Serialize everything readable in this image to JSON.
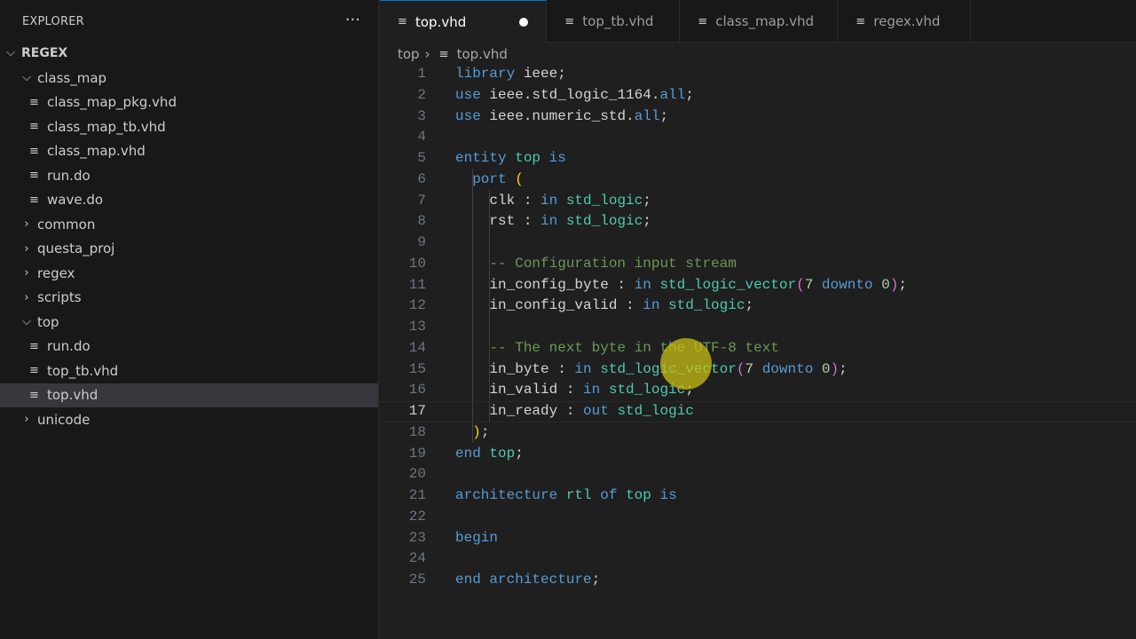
{
  "sidebar": {
    "title": "EXPLORER",
    "more": "···",
    "root": "REGEX",
    "items": [
      {
        "label": "class_map",
        "type": "folder",
        "open": true,
        "depth": 1
      },
      {
        "label": "class_map_pkg.vhd",
        "type": "file",
        "depth": 2
      },
      {
        "label": "class_map_tb.vhd",
        "type": "file",
        "depth": 2
      },
      {
        "label": "class_map.vhd",
        "type": "file",
        "depth": 2
      },
      {
        "label": "run.do",
        "type": "file",
        "depth": 2
      },
      {
        "label": "wave.do",
        "type": "file",
        "depth": 2
      },
      {
        "label": "common",
        "type": "folder",
        "open": false,
        "depth": 1
      },
      {
        "label": "questa_proj",
        "type": "folder",
        "open": false,
        "depth": 1
      },
      {
        "label": "regex",
        "type": "folder",
        "open": false,
        "depth": 1
      },
      {
        "label": "scripts",
        "type": "folder",
        "open": false,
        "depth": 1
      },
      {
        "label": "top",
        "type": "folder",
        "open": true,
        "depth": 1
      },
      {
        "label": "run.do",
        "type": "file",
        "depth": 2
      },
      {
        "label": "top_tb.vhd",
        "type": "file",
        "depth": 2
      },
      {
        "label": "top.vhd",
        "type": "file",
        "depth": 2,
        "selected": true
      },
      {
        "label": "unicode",
        "type": "folder",
        "open": false,
        "depth": 1
      }
    ]
  },
  "tabs": [
    {
      "label": "top.vhd",
      "active": true,
      "modified": true
    },
    {
      "label": "top_tb.vhd"
    },
    {
      "label": "class_map.vhd"
    },
    {
      "label": "regex.vhd"
    }
  ],
  "breadcrumb": {
    "folder": "top",
    "file": "top.vhd"
  },
  "editor": {
    "current_line": 17,
    "lines": [
      [
        [
          "kw",
          "library"
        ],
        [
          "id",
          " ieee;"
        ]
      ],
      [
        [
          "kw",
          "use"
        ],
        [
          "id",
          " ieee.std_logic_1164."
        ],
        [
          "kw",
          "all"
        ],
        [
          "id",
          ";"
        ]
      ],
      [
        [
          "kw",
          "use"
        ],
        [
          "id",
          " ieee.numeric_std."
        ],
        [
          "kw",
          "all"
        ],
        [
          "id",
          ";"
        ]
      ],
      [],
      [
        [
          "kw",
          "entity"
        ],
        [
          "id",
          " "
        ],
        [
          "ty",
          "top"
        ],
        [
          "id",
          " "
        ],
        [
          "kw",
          "is"
        ]
      ],
      [
        [
          "id",
          "  "
        ],
        [
          "kw",
          "port"
        ],
        [
          "id",
          " "
        ],
        [
          "p1",
          "("
        ]
      ],
      [
        [
          "id",
          "    clk : "
        ],
        [
          "kw",
          "in"
        ],
        [
          "id",
          " "
        ],
        [
          "ty",
          "std_logic"
        ],
        [
          "id",
          ";"
        ]
      ],
      [
        [
          "id",
          "    rst : "
        ],
        [
          "kw",
          "in"
        ],
        [
          "id",
          " "
        ],
        [
          "ty",
          "std_logic"
        ],
        [
          "id",
          ";"
        ]
      ],
      [],
      [
        [
          "id",
          "    "
        ],
        [
          "cm",
          "-- Configuration input stream"
        ]
      ],
      [
        [
          "id",
          "    in_config_byte : "
        ],
        [
          "kw",
          "in"
        ],
        [
          "id",
          " "
        ],
        [
          "ty",
          "std_logic_vector"
        ],
        [
          "p2",
          "("
        ],
        [
          "nm",
          "7"
        ],
        [
          "id",
          " "
        ],
        [
          "kw",
          "downto"
        ],
        [
          "id",
          " "
        ],
        [
          "nm",
          "0"
        ],
        [
          "p2",
          ")"
        ],
        [
          "id",
          ";"
        ]
      ],
      [
        [
          "id",
          "    in_config_valid : "
        ],
        [
          "kw",
          "in"
        ],
        [
          "id",
          " "
        ],
        [
          "ty",
          "std_logic"
        ],
        [
          "id",
          ";"
        ]
      ],
      [],
      [
        [
          "id",
          "    "
        ],
        [
          "cm",
          "-- The next byte in the UTF-8 text"
        ]
      ],
      [
        [
          "id",
          "    in_byte : "
        ],
        [
          "kw",
          "in"
        ],
        [
          "id",
          " "
        ],
        [
          "ty",
          "std_logic_vector"
        ],
        [
          "p2",
          "("
        ],
        [
          "nm",
          "7"
        ],
        [
          "id",
          " "
        ],
        [
          "kw",
          "downto"
        ],
        [
          "id",
          " "
        ],
        [
          "nm",
          "0"
        ],
        [
          "p2",
          ")"
        ],
        [
          "id",
          ";"
        ]
      ],
      [
        [
          "id",
          "    in_valid : "
        ],
        [
          "kw",
          "in"
        ],
        [
          "id",
          " "
        ],
        [
          "ty",
          "std_logic"
        ],
        [
          "id",
          ";"
        ]
      ],
      [
        [
          "id",
          "    in_ready : "
        ],
        [
          "kw",
          "out"
        ],
        [
          "id",
          " "
        ],
        [
          "ty",
          "std_logic"
        ]
      ],
      [
        [
          "id",
          "  "
        ],
        [
          "p1",
          ")"
        ],
        [
          "id",
          ";"
        ]
      ],
      [
        [
          "kw",
          "end"
        ],
        [
          "id",
          " "
        ],
        [
          "ty",
          "top"
        ],
        [
          "id",
          ";"
        ]
      ],
      [],
      [
        [
          "kw",
          "architecture"
        ],
        [
          "id",
          " "
        ],
        [
          "ty",
          "rtl"
        ],
        [
          "id",
          " "
        ],
        [
          "kw",
          "of"
        ],
        [
          "id",
          " "
        ],
        [
          "ty",
          "top"
        ],
        [
          "id",
          " "
        ],
        [
          "kw",
          "is"
        ]
      ],
      [],
      [
        [
          "kw",
          "begin"
        ]
      ],
      [],
      [
        [
          "kw",
          "end"
        ],
        [
          "id",
          " "
        ],
        [
          "kw",
          "architecture"
        ],
        [
          "id",
          ";"
        ]
      ]
    ]
  },
  "colors": {
    "accent": "#0078d4",
    "keyword": "#569cd6",
    "type": "#4ec9b0",
    "comment": "#6a9955",
    "number": "#b5cea8"
  }
}
